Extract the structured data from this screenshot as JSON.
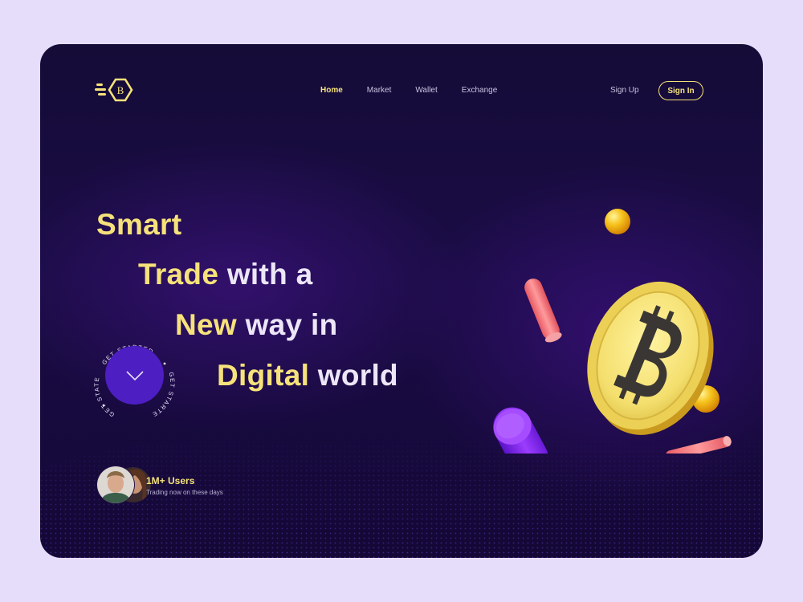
{
  "nav": {
    "logo_letter": "B",
    "links": [
      {
        "label": "Home",
        "active": true
      },
      {
        "label": "Market",
        "active": false
      },
      {
        "label": "Wallet",
        "active": false
      },
      {
        "label": "Exchange",
        "active": false
      }
    ],
    "sign_up": "Sign Up",
    "sign_in": "Sign In"
  },
  "hero": {
    "line1_highlight": "Smart",
    "line2_highlight": "Trade",
    "line2_rest": "with a",
    "line3_highlight": "New",
    "line3_rest": "way in",
    "line4_highlight": "Digital",
    "line4_rest": "world"
  },
  "cta": {
    "ring_text_top": "GET STARTED",
    "ring_text_bottom": "GET STARTED",
    "ring_text_left": "GET STATED",
    "icon": "chevron-down-icon"
  },
  "users": {
    "title": "1M+ Users",
    "subtitle": "Trading now on these days"
  },
  "colors": {
    "accent": "#f6e27a",
    "background": "#e6ddfa",
    "card": "#1a0c45",
    "button": "#4d1ec2"
  }
}
